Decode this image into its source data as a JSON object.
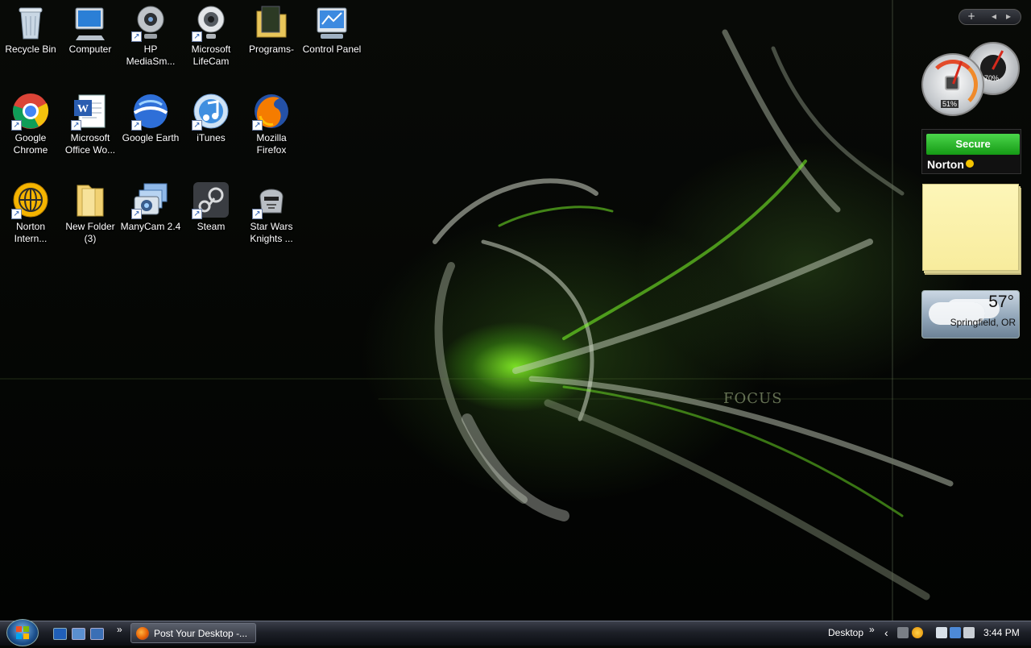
{
  "desktop": {
    "icons": [
      {
        "label": "Recycle Bin",
        "icon": "recycle-bin-icon"
      },
      {
        "label": "Computer",
        "icon": "computer-icon"
      },
      {
        "label": "HP MediaSm...",
        "icon": "webcam-icon"
      },
      {
        "label": "Microsoft LifeCam",
        "icon": "webcam-icon"
      },
      {
        "label": "Programs-",
        "icon": "folder-icon"
      },
      {
        "label": "Control Panel",
        "icon": "control-panel-icon"
      },
      {
        "label": "Google Chrome",
        "icon": "chrome-icon"
      },
      {
        "label": "Microsoft Office Wo...",
        "icon": "word-icon"
      },
      {
        "label": "Google Earth",
        "icon": "google-earth-icon"
      },
      {
        "label": "iTunes",
        "icon": "itunes-icon"
      },
      {
        "label": "Mozilla Firefox",
        "icon": "firefox-icon"
      },
      {
        "label": "Norton Intern...",
        "icon": "norton-icon"
      },
      {
        "label": "New Folder (3)",
        "icon": "folder-icon"
      },
      {
        "label": "ManyCam 2.4",
        "icon": "manycam-icon"
      },
      {
        "label": "Steam",
        "icon": "steam-icon"
      },
      {
        "label": "Star Wars Knights ...",
        "icon": "star-wars-icon"
      }
    ],
    "wallpaper_text": "FOCUS"
  },
  "sidebar": {
    "controls": {
      "add": "+",
      "prev": "◂",
      "next": "▸"
    },
    "cpu_meter": {
      "cpu": "51%",
      "memory": "70%"
    },
    "norton": {
      "status": "Secure",
      "brand": "Norton"
    },
    "weather": {
      "temperature": "57°",
      "location": "Springfield, OR"
    }
  },
  "taskbar": {
    "quick_launch_more": "»",
    "window_button": "Post Your Desktop -...",
    "toolbar_label": "Desktop",
    "toolbar_more": "»",
    "tray_expand": "‹",
    "clock": "3:44 PM"
  },
  "colors": {
    "wallpaper_accent": "#7dff2a",
    "norton_green": "#22b022",
    "note_yellow": "#fdf6b8"
  }
}
